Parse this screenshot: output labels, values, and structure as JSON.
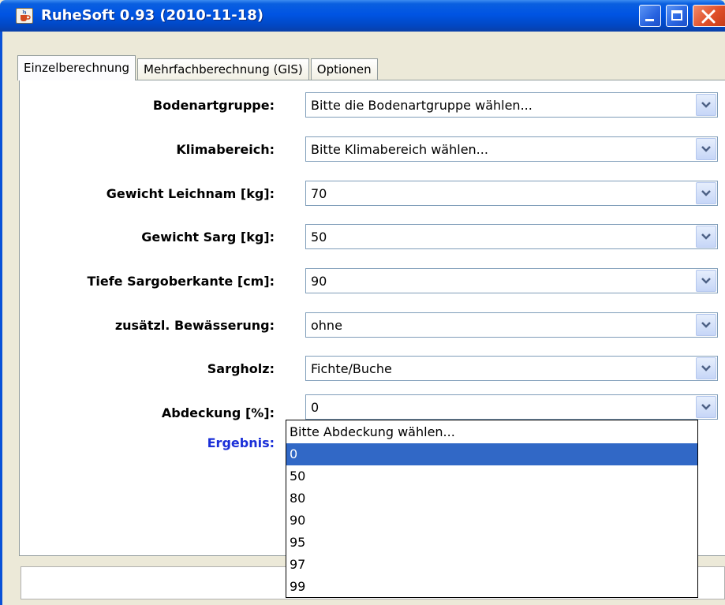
{
  "window": {
    "title": "RuheSoft 0.93 (2010-11-18)",
    "title_icon": "java-cup-icon"
  },
  "tabs": [
    {
      "label": "Einzelberechnung",
      "active": true
    },
    {
      "label": "Mehrfachberechnung (GIS)",
      "active": false
    },
    {
      "label": "Optionen",
      "active": false
    }
  ],
  "form": {
    "fields": [
      {
        "label": "Bodenartgruppe:",
        "value": "Bitte die Bodenartgruppe wählen..."
      },
      {
        "label": "Klimabereich:",
        "value": "Bitte Klimabereich wählen..."
      },
      {
        "label": "Gewicht Leichnam [kg]:",
        "value": "70"
      },
      {
        "label": "Gewicht Sarg [kg]:",
        "value": "50"
      },
      {
        "label": "Tiefe Sargoberkante [cm]:",
        "value": "90"
      },
      {
        "label": "zusätzl. Bewässerung:",
        "value": "ohne"
      },
      {
        "label": "Sargholz:",
        "value": "Fichte/Buche"
      },
      {
        "label": "Abdeckung [%]:",
        "value": "0"
      }
    ],
    "result_label": "Ergebnis:"
  },
  "dropdown": {
    "options": [
      "Bitte Abdeckung wählen...",
      "0",
      "50",
      "80",
      "90",
      "95",
      "97",
      "99"
    ],
    "selected": "0"
  },
  "colors": {
    "titlebar": "#0054e3",
    "selection": "#3168c6",
    "result_label": "#1a2fd8"
  }
}
